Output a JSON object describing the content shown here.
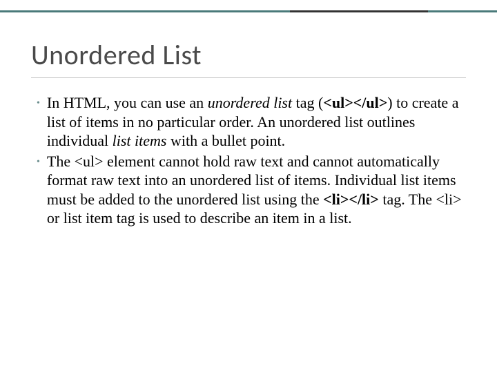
{
  "heading": "Unordered List",
  "bullets": [
    {
      "segments": [
        {
          "t": "In HTML, you can use an "
        },
        {
          "t": "unordered list",
          "i": true
        },
        {
          "t": " tag ("
        },
        {
          "t": "<ul></ul>",
          "b": true
        },
        {
          "t": ") to create a list of items in no particular order. An unordered list outlines individual "
        },
        {
          "t": "list items",
          "i": true
        },
        {
          "t": " with a bullet point."
        }
      ]
    },
    {
      "segments": [
        {
          "t": "The <ul> element cannot hold raw text and cannot automatically format raw text into an unordered list of items. Individual list items must be added to the unordered list using the "
        },
        {
          "t": "<li></li>",
          "b": true
        },
        {
          "t": " tag. The <li> or list item tag is used to describe an item in a list."
        }
      ]
    }
  ]
}
